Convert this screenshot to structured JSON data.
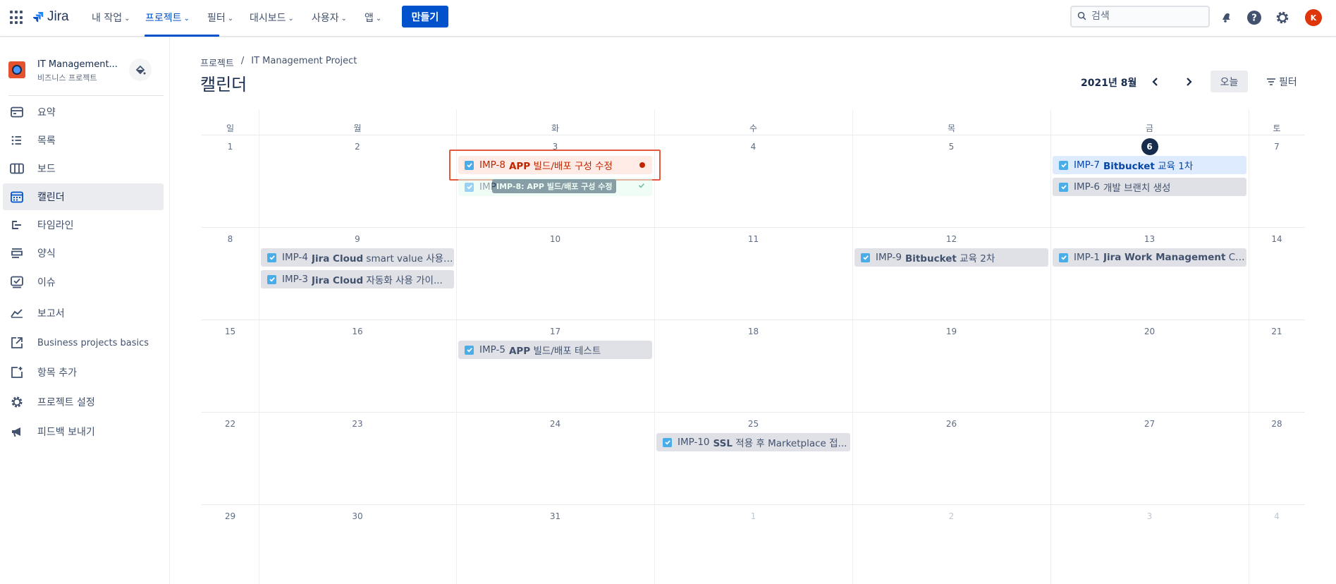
{
  "topnav": {
    "logo": "Jira",
    "items": [
      {
        "label": "내 작업"
      },
      {
        "label": "프로젝트"
      },
      {
        "label": "필터"
      },
      {
        "label": "대시보드"
      },
      {
        "label": "사용자"
      },
      {
        "label": "앱"
      }
    ],
    "active_item": "프로젝트",
    "create_label": "만들기",
    "search_placeholder": "검색",
    "avatar_initial": "K",
    "brand_color": "#0052cc"
  },
  "sidebar": {
    "project_name": "IT Management...",
    "project_type": "비즈니스 프로젝트",
    "items": [
      {
        "label": "요약",
        "icon": "summary-icon"
      },
      {
        "label": "목록",
        "icon": "list-icon"
      },
      {
        "label": "보드",
        "icon": "board-icon"
      },
      {
        "label": "캘린더",
        "icon": "calendar-icon",
        "active": true
      },
      {
        "label": "타임라인",
        "icon": "timeline-icon"
      },
      {
        "label": "양식",
        "icon": "form-icon"
      },
      {
        "label": "이슈",
        "icon": "issues-icon"
      },
      {
        "label": "보고서",
        "icon": "reports-icon"
      },
      {
        "label": "Business projects basics",
        "icon": "external-link-icon"
      },
      {
        "label": "항목 추가",
        "icon": "add-item-icon"
      },
      {
        "label": "프로젝트 설정",
        "icon": "settings-icon"
      },
      {
        "label": "피드백 보내기",
        "icon": "megaphone-icon"
      }
    ]
  },
  "main": {
    "breadcrumb": [
      "프로젝트",
      "/",
      "IT Management Project"
    ],
    "title": "캘린더",
    "month_label": "2021년 8월",
    "today_label": "오늘",
    "filter_label": "필터"
  },
  "calendar": {
    "weekdays": [
      "일",
      "월",
      "화",
      "수",
      "목",
      "금",
      "토"
    ],
    "weeks": [
      [
        {
          "n": "1"
        },
        {
          "n": "2"
        },
        {
          "n": "3"
        },
        {
          "n": "4"
        },
        {
          "n": "5"
        },
        {
          "n": "6",
          "today": true
        },
        {
          "n": "7"
        }
      ],
      [
        {
          "n": "8"
        },
        {
          "n": "9"
        },
        {
          "n": "10"
        },
        {
          "n": "11"
        },
        {
          "n": "12"
        },
        {
          "n": "13"
        },
        {
          "n": "14"
        }
      ],
      [
        {
          "n": "15"
        },
        {
          "n": "16"
        },
        {
          "n": "17"
        },
        {
          "n": "18"
        },
        {
          "n": "19"
        },
        {
          "n": "20"
        },
        {
          "n": "21"
        }
      ],
      [
        {
          "n": "22"
        },
        {
          "n": "23"
        },
        {
          "n": "24"
        },
        {
          "n": "25"
        },
        {
          "n": "26"
        },
        {
          "n": "27"
        },
        {
          "n": "28"
        }
      ],
      [
        {
          "n": "29"
        },
        {
          "n": "30"
        },
        {
          "n": "31"
        },
        {
          "n": "1",
          "muted": true
        },
        {
          "n": "2",
          "muted": true
        },
        {
          "n": "3",
          "muted": true
        },
        {
          "n": "4",
          "muted": true
        }
      ]
    ],
    "events": [
      {
        "key": "IMP-8",
        "title": "APP 빌드/배포 구성 수정",
        "state": "danger",
        "week": 0,
        "day": 2,
        "slot": 0,
        "status_icon": "error-icon"
      },
      {
        "key": "IMP",
        "title": "",
        "state": "success",
        "week": 0,
        "day": 2,
        "slot": 1,
        "status_icon": "check-icon"
      },
      {
        "key": "IMP-7",
        "title": "Bitbucket 교육 1차",
        "state": "selected",
        "week": 0,
        "day": 5,
        "slot": 0
      },
      {
        "key": "IMP-6",
        "title": "개발 브랜치 생성",
        "state": "normal",
        "week": 0,
        "day": 5,
        "slot": 1
      },
      {
        "key": "IMP-4",
        "title": "Jira Cloud smart value 사용 ...",
        "state": "normal",
        "week": 1,
        "day": 1,
        "slot": 0
      },
      {
        "key": "IMP-3",
        "title": "Jira Cloud 자동화 사용 가이...",
        "state": "normal",
        "week": 1,
        "day": 1,
        "slot": 1
      },
      {
        "key": "IMP-9",
        "title": "Bitbucket 교육 2차",
        "state": "normal",
        "week": 1,
        "day": 4,
        "slot": 0
      },
      {
        "key": "IMP-1",
        "title": "Jira Work Management Clou...",
        "state": "normal",
        "week": 1,
        "day": 5,
        "slot": 0
      },
      {
        "key": "IMP-5",
        "title": "APP 빌드/배포 테스트",
        "state": "normal",
        "week": 2,
        "day": 2,
        "slot": 0
      },
      {
        "key": "IMP-10",
        "title": "SSL 적용 후 Marketplace 접...",
        "state": "normal",
        "week": 3,
        "day": 3,
        "slot": 0
      }
    ],
    "tooltip": "IMP-8: APP 빌드/배포 구성 수정"
  }
}
